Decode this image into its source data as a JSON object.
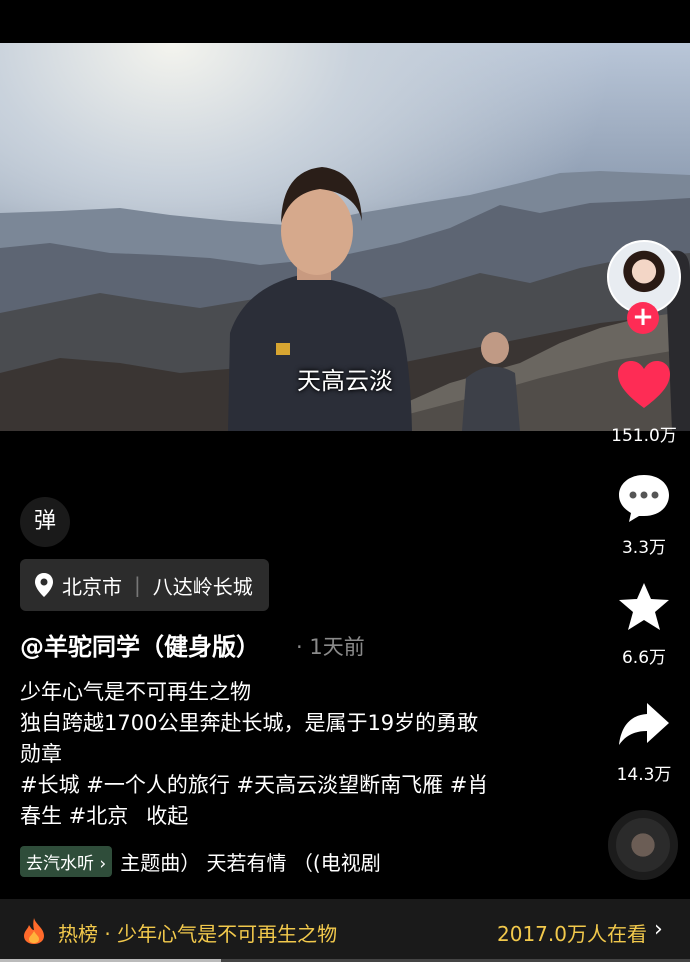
{
  "video": {
    "subtitle": "天高云淡"
  },
  "rail": {
    "like_count": "151.0万",
    "comment_count": "3.3万",
    "favorite_count": "6.6万",
    "share_count": "14.3万",
    "follow_symbol": "+"
  },
  "danmu_label": "弹",
  "location": {
    "city": "北京市",
    "place": "八达岭长城"
  },
  "post": {
    "author": "@羊驼同学（健身版）",
    "time": "· 1天前",
    "lines": [
      "少年心气是不可再生之物",
      "独自跨越1700公里奔赴长城，是属于19岁的勇敢",
      "勋章",
      "#长城 #一个人的旅行 #天高云淡望断南飞雁 #肖",
      "春生 #北京"
    ],
    "collapse": "收起"
  },
  "music": {
    "pill": "去汽水听 ›",
    "text": "主题曲） 天若有情 （(电视剧"
  },
  "hotbar": {
    "text": "热榜 · 少年心气是不可再生之物",
    "count": "2017.0万人在看",
    "arrow": "›"
  },
  "progress": 0.32,
  "colors": {
    "like": "#fe2c55",
    "hot": "#f2c94c",
    "music_pill": "#2f4d3a"
  }
}
